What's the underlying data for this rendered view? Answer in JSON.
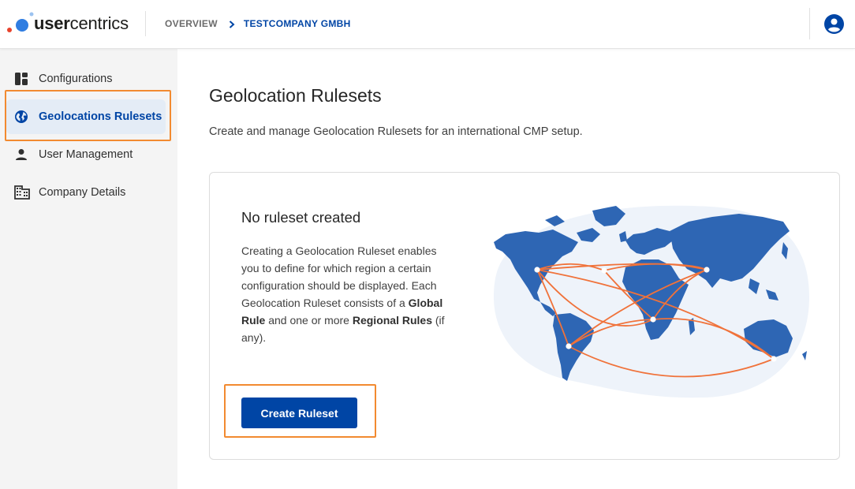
{
  "brand": {
    "name_prefix": "user",
    "name_suffix": "centrics",
    "colors": {
      "primary": "#0045a5",
      "accent_orange": "#f28a30",
      "logo_red": "#e8432c",
      "logo_blue": "#2f7de1"
    }
  },
  "header": {
    "breadcrumb": {
      "overview": "OVERVIEW",
      "separator_icon": "chevron-right-icon",
      "current": "TESTCOMPANY GMBH"
    },
    "user_icon": "account-circle-icon"
  },
  "sidebar": {
    "items": [
      {
        "label": "Configurations",
        "icon": "dashboard-icon",
        "active": false
      },
      {
        "label": "Geolocations Rulesets",
        "icon": "globe-icon",
        "active": true
      },
      {
        "label": "User Management",
        "icon": "person-icon",
        "active": false
      },
      {
        "label": "Company Details",
        "icon": "building-icon",
        "active": false
      }
    ]
  },
  "main": {
    "title": "Geolocation Rulesets",
    "description": "Create and manage Geolocation Rulesets for an international CMP setup.",
    "empty_state": {
      "title": "No ruleset created",
      "body_part1": "Creating a Geolocation Ruleset enables you to define for which region a certain configuration should be displayed. Each Geolocation Ruleset consists of a ",
      "body_bold1": "Global Rule",
      "body_part2": " and one or more ",
      "body_bold2": "Regional Rules",
      "body_part3": " (if any).",
      "button_label": "Create Ruleset",
      "illustration": "world-map-connections-illustration"
    }
  }
}
